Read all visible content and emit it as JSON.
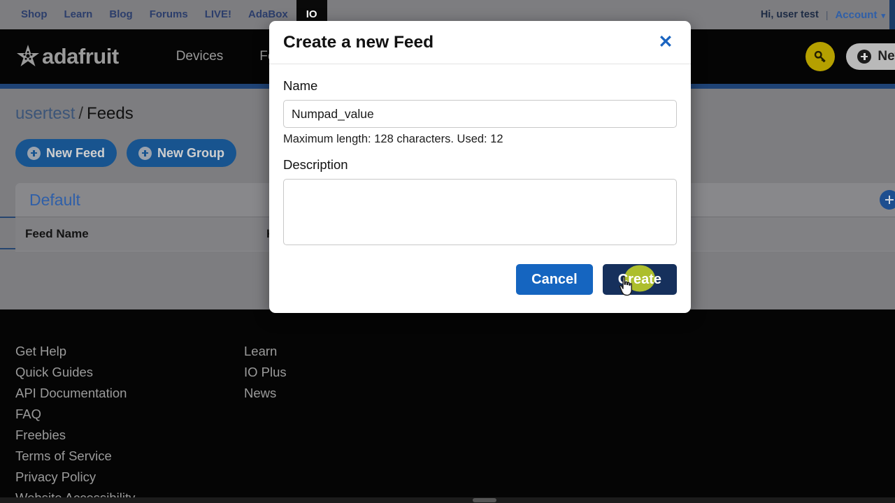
{
  "topbar": {
    "links": [
      "Shop",
      "Learn",
      "Blog",
      "Forums",
      "LIVE!",
      "AdaBox"
    ],
    "active_tab": "IO",
    "greeting": "Hi, user test",
    "separator": "|",
    "account_label": "Account",
    "caret_icon": "chevron-down-icon"
  },
  "mainnav": {
    "brand": "adafruit",
    "brand_icon": "adafruit-flower-logo",
    "links": [
      "Devices",
      "Feeds"
    ],
    "key_icon": "key-icon",
    "new_device_label": "New De",
    "plus_icon": "plus-circle-icon"
  },
  "content": {
    "breadcrumb": {
      "user": "usertest",
      "slash": "/",
      "current": "Feeds"
    },
    "actions": [
      {
        "label": "New Feed",
        "icon": "plus-circle-icon"
      },
      {
        "label": "New Group",
        "icon": "plus-circle-icon"
      }
    ],
    "help_icon": "question-mark-icon",
    "group": {
      "title": "Default",
      "add_icon": "plus-circle-icon"
    },
    "table": {
      "columns": [
        "Feed Name",
        "K"
      ]
    }
  },
  "footer": {
    "column_one": [
      "Get Help",
      "Quick Guides",
      "API Documentation",
      "FAQ",
      "Freebies",
      "Terms of Service",
      "Privacy Policy",
      "Website Accessibility"
    ],
    "column_two": [
      "Learn",
      "IO Plus",
      "News"
    ]
  },
  "modal": {
    "title": "Create a new Feed",
    "close_icon": "close-icon",
    "name_label": "Name",
    "name_value": "Numpad_value",
    "name_placeholder": "",
    "helper_text": "Maximum length: 128 characters. Used: 12",
    "description_label": "Description",
    "description_value": "",
    "description_placeholder": "",
    "cancel_label": "Cancel",
    "create_label": "Create",
    "cursor_icon": "pointer-hand-cursor"
  },
  "colors": {
    "topbar_bg": "#7d7d80",
    "nav_bg": "#050505",
    "nav_rule": "#1f4375",
    "accent_blue": "#1565c0",
    "create_navy": "#16305c",
    "pill_blue": "#18548f",
    "key_yellow": "#b5a000",
    "click_halo": "#b5c62a",
    "overlay_gray": "#7d7d80"
  }
}
